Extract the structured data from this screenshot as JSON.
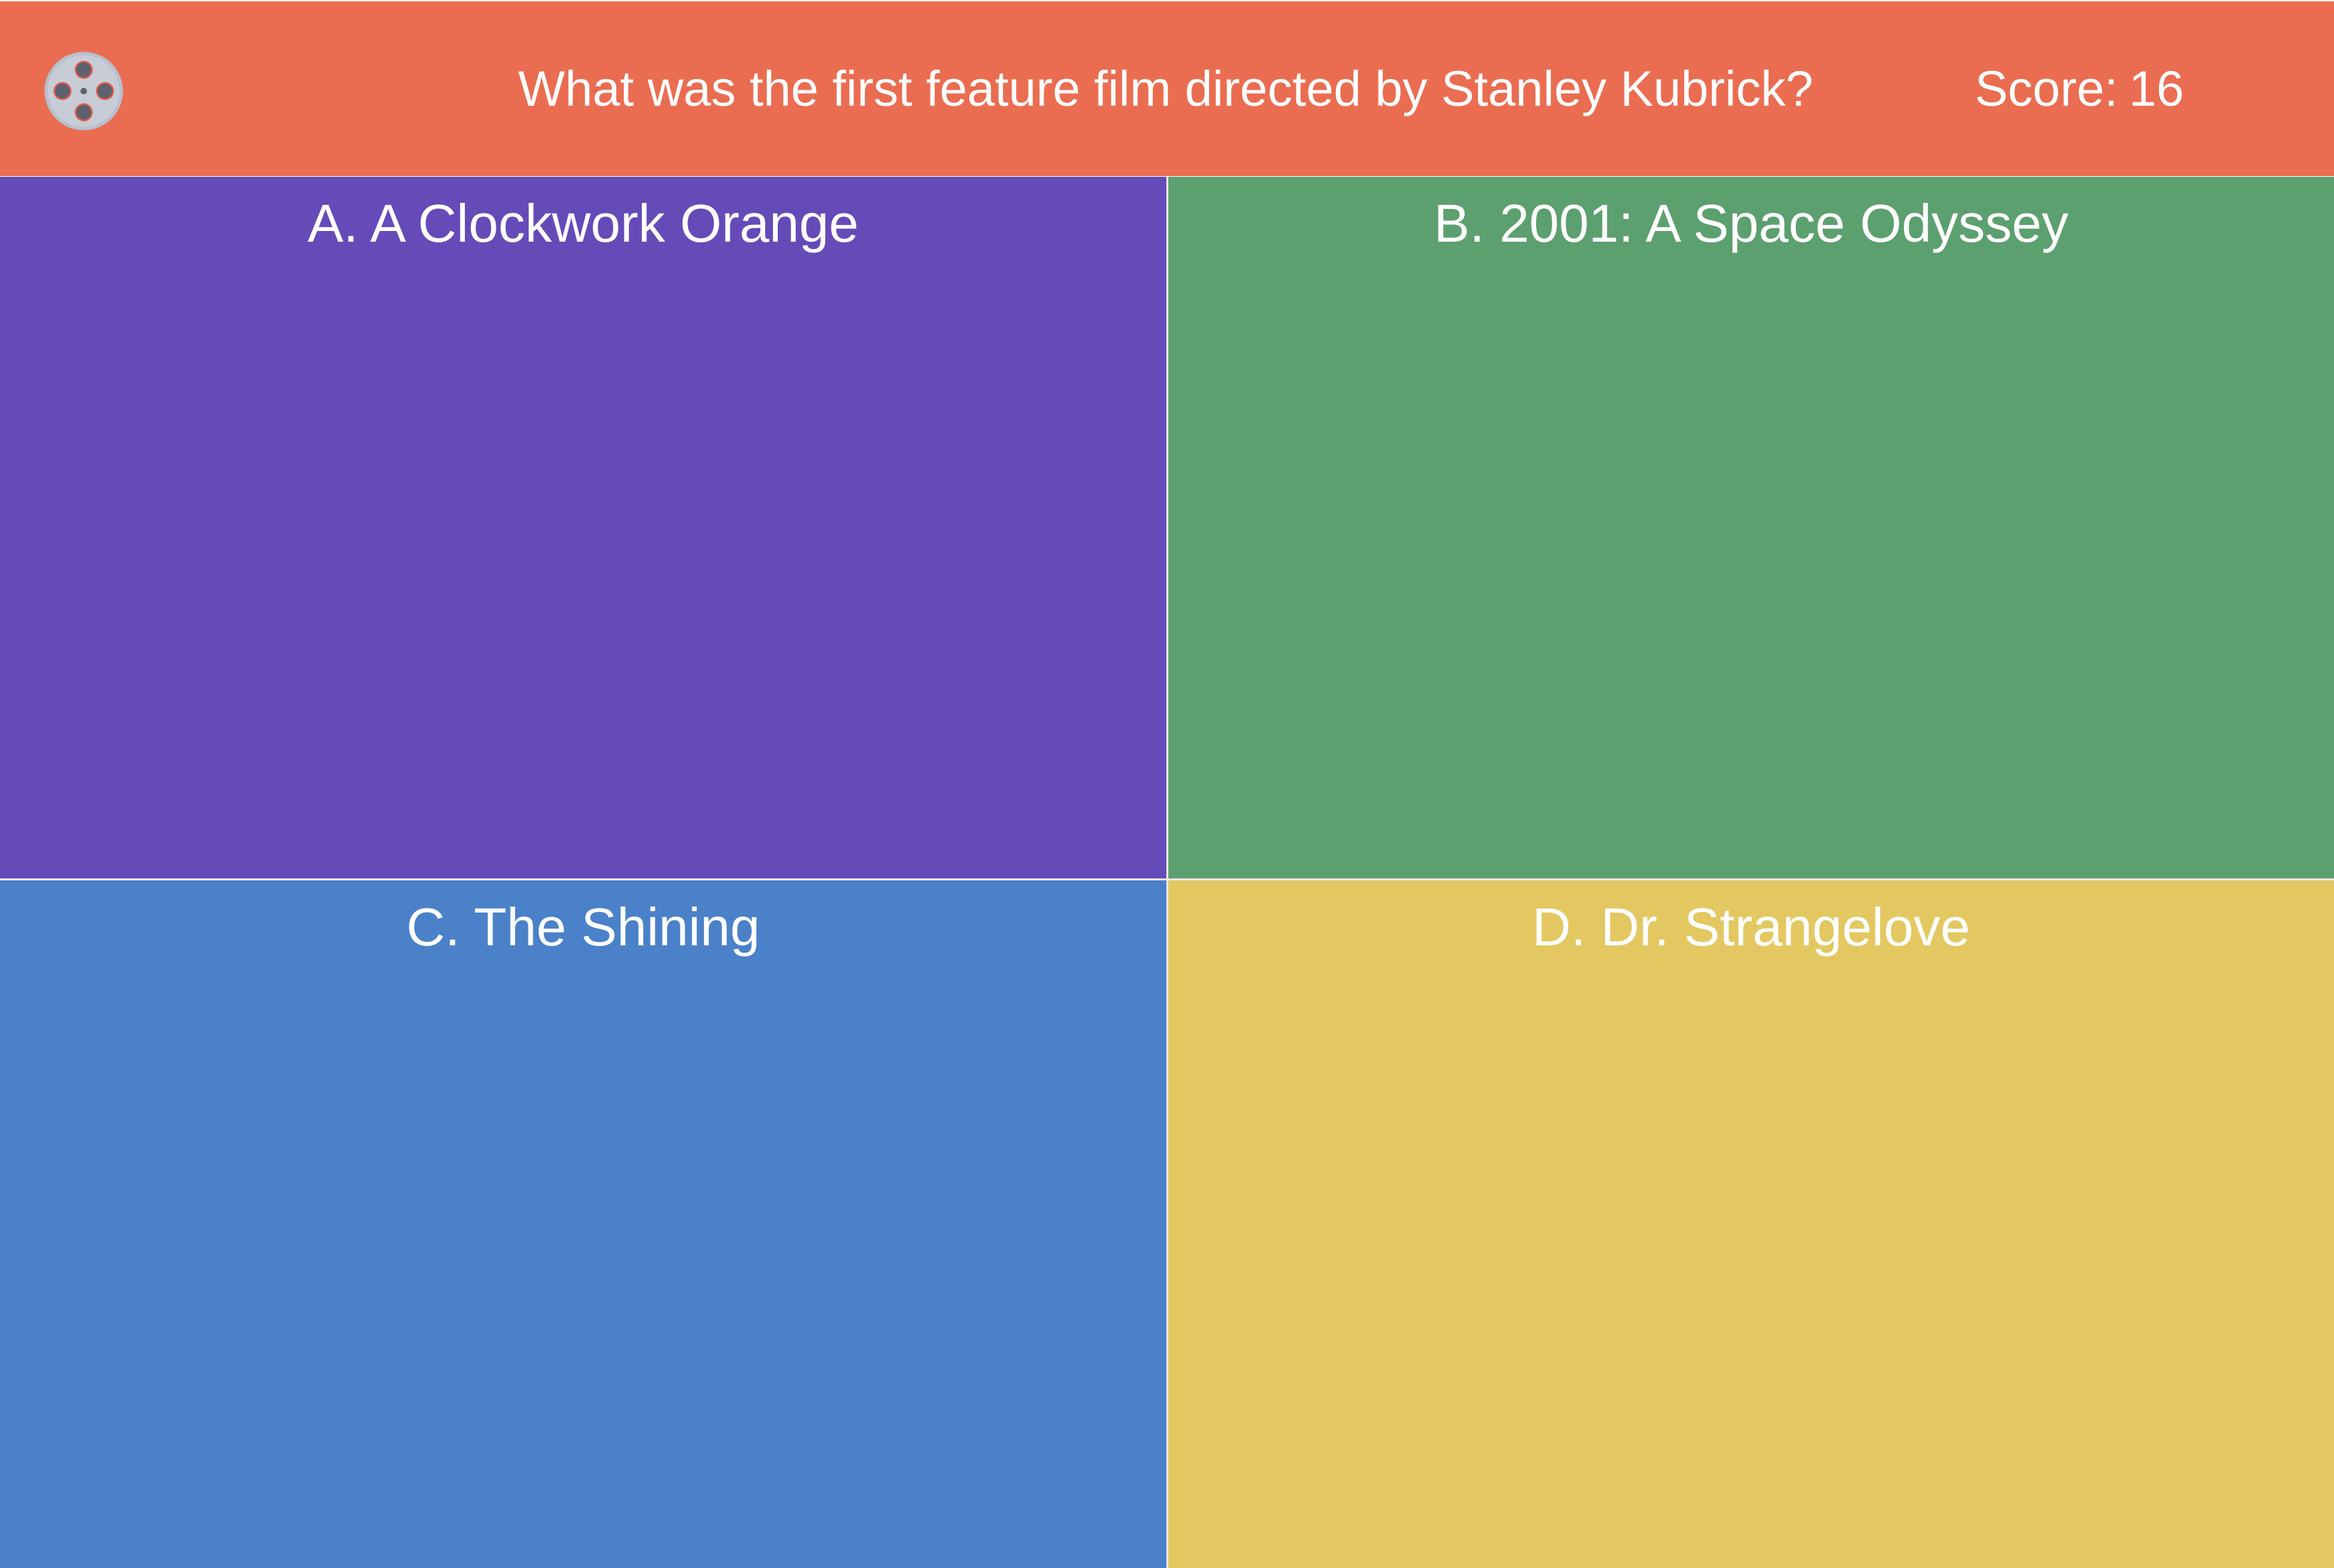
{
  "header": {
    "logo_icon": "film-reel-icon",
    "question": "What was the first feature film directed by Stanley Kubrick?",
    "score_label": "Score:",
    "score_value": "16",
    "background_color": "#ea6d51"
  },
  "answers": [
    {
      "letter": "A.",
      "label": "A Clockwork Orange",
      "color": "#654bb7"
    },
    {
      "letter": "B.",
      "label": "2001: A Space Odyssey",
      "color": "#5ca06f"
    },
    {
      "letter": "C.",
      "label": "The Shining",
      "color": "#4b81c8"
    },
    {
      "letter": "D.",
      "label": "Dr. Strangelove",
      "color": "#e3c862"
    }
  ]
}
